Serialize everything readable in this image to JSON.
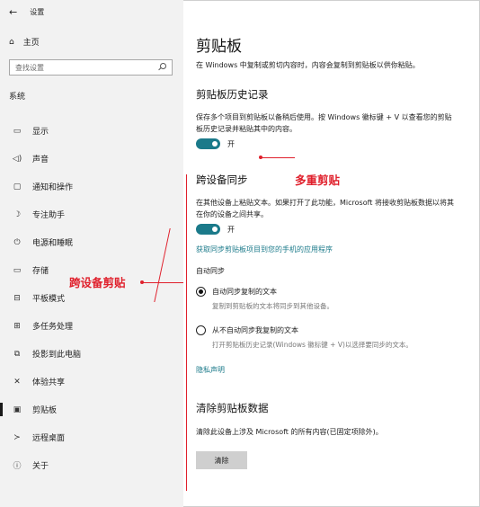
{
  "window": {
    "title": "设置"
  },
  "sidebar": {
    "home_label": "主页",
    "search_placeholder": "查找设置",
    "section": "系统",
    "items": [
      {
        "icon": "▭",
        "label": "显示"
      },
      {
        "icon": "◁)",
        "label": "声音"
      },
      {
        "icon": "▢",
        "label": "通知和操作"
      },
      {
        "icon": "☽",
        "label": "专注助手"
      },
      {
        "icon": "⏻",
        "label": "电源和睡眠"
      },
      {
        "icon": "▭",
        "label": "存储"
      },
      {
        "icon": "⊟",
        "label": "平板模式"
      },
      {
        "icon": "⊞",
        "label": "多任务处理"
      },
      {
        "icon": "⧉",
        "label": "投影到此电脑"
      },
      {
        "icon": "✕",
        "label": "体验共享"
      },
      {
        "icon": "▣",
        "label": "剪贴板"
      },
      {
        "icon": "≻",
        "label": "远程桌面"
      },
      {
        "icon": "ⓘ",
        "label": "关于"
      }
    ],
    "active_index": 10
  },
  "main": {
    "title": "剪贴板",
    "intro": "在 Windows 中复制或剪切内容时，内容会复制到剪贴板以供你粘贴。",
    "history": {
      "heading": "剪贴板历史记录",
      "desc": "保存多个项目到剪贴板以备稍后使用。按 Windows 徽标键 + V 以查看您的剪贴板历史记录并粘贴其中的内容。",
      "toggle_label": "开"
    },
    "sync": {
      "heading": "跨设备同步",
      "desc": "在其他设备上粘贴文本。如果打开了此功能，Microsoft 将接收剪贴板数据以将其在你的设备之间共享。",
      "toggle_label": "开",
      "phone_link": "获取同步剪贴板项目到您的手机的应用程序",
      "auto_sync_label": "自动同步",
      "option1_title": "自动同步复制的文本",
      "option1_sub": "复制到剪贴板的文本将同步到其他设备。",
      "option2_title": "从不自动同步我复制的文本",
      "option2_sub": "打开剪贴板历史记录(Windows 徽标键 + V)以选择要同步的文本。",
      "privacy_link": "隐私声明"
    },
    "clear": {
      "heading": "清除剪贴板数据",
      "desc": "清除此设备上涉及 Microsoft 的所有内容(已固定项除外)。",
      "button": "清除"
    }
  },
  "annotations": {
    "multi_clipboard": "多重剪贴",
    "cross_device": "跨设备剪贴"
  },
  "colors": {
    "accent": "#1b7a8a",
    "annotation": "#e0202c",
    "sidebar_bg": "#f2f2f2"
  }
}
